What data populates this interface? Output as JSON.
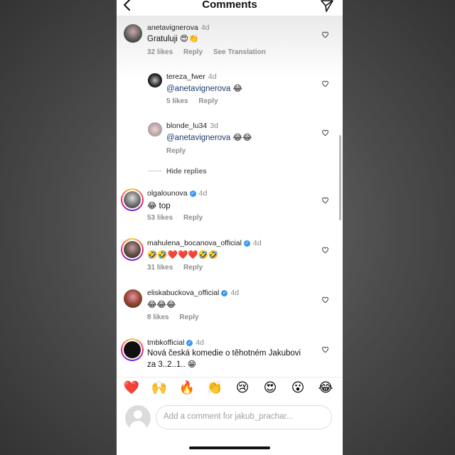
{
  "header": {
    "title": "Comments"
  },
  "comments": [
    {
      "username": "anetavignerova",
      "time": "4d",
      "text": "Gratuluji 😍👏",
      "likes": "32 likes",
      "reply": "Reply",
      "translate": "See Translation"
    },
    {
      "username": "tereza_fwer",
      "time": "4d",
      "mention": "@anetavignerova",
      "emoji": "😂",
      "likes": "5 likes",
      "reply": "Reply"
    },
    {
      "username": "blonde_lu34",
      "time": "3d",
      "mention": "@anetavignerova",
      "emoji": "😂😂",
      "reply": "Reply"
    },
    {
      "username": "olgalounova",
      "time": "4d",
      "text": "😂 top",
      "likes": "53 likes",
      "reply": "Reply"
    },
    {
      "username": "mahulena_bocanova_official",
      "time": "4d",
      "text": "🤣🤣❤️❤️❤️🤣🤣",
      "likes": "31 likes",
      "reply": "Reply"
    },
    {
      "username": "eliskabuckova_official",
      "time": "4d",
      "text": "😂😂😂",
      "likes": "8 likes",
      "reply": "Reply"
    },
    {
      "username": "tmbkofficial",
      "time": "4d",
      "text_line1": "Nová česká komedie o těhotném Jakubovi",
      "text_line2": "za 3..2..1.. 😁"
    }
  ],
  "hide_replies": "Hide replies",
  "quick_emojis": [
    "❤️",
    "🙌",
    "🔥",
    "👏",
    "😢",
    "😍",
    "😮",
    "😂"
  ],
  "composer": {
    "placeholder": "Add a comment for jakub_prachar..."
  }
}
